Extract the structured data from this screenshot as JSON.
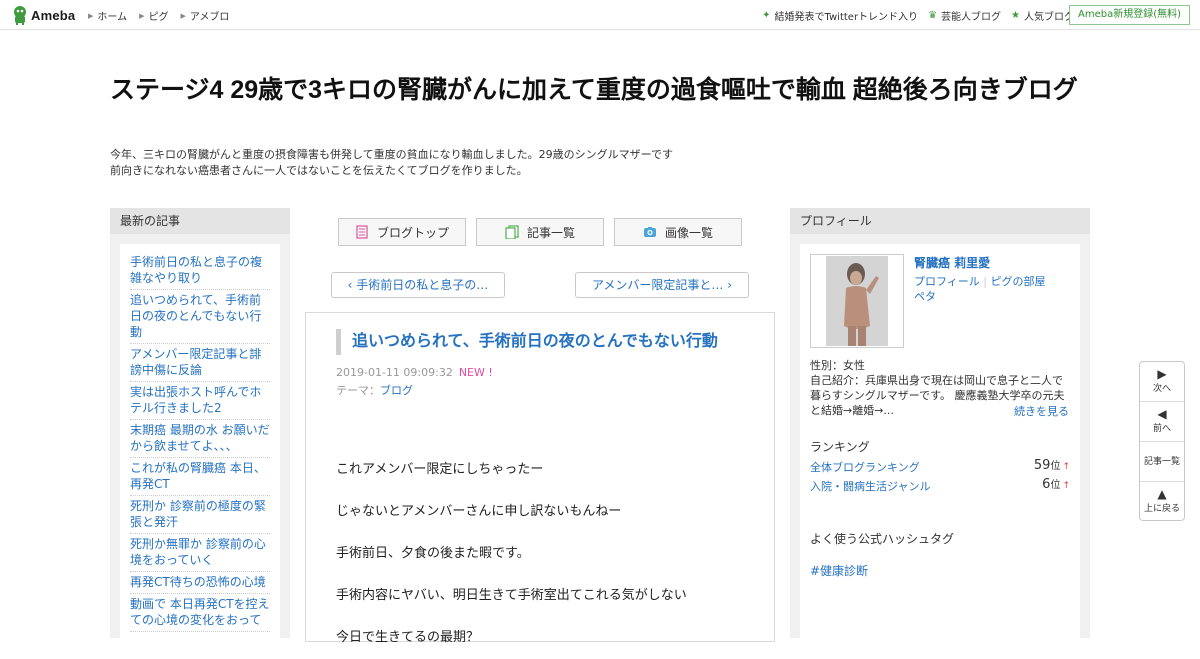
{
  "topbar": {
    "logo": "Ameba",
    "nav": [
      "ホーム",
      "ピグ",
      "アメブロ"
    ],
    "right_links": [
      {
        "icon": "sparkle-icon",
        "label": "結婚発表でTwitterトレンド入り"
      },
      {
        "icon": "crown-icon",
        "label": "芸能人ブログ"
      },
      {
        "icon": "star-icon",
        "label": "人気ブログ"
      }
    ],
    "register": "Ameba新規登録(無料)"
  },
  "blog": {
    "title": "ステージ4 29歳で3キロの腎臓がんに加えて重度の過食嘔吐で輸血 超絶後ろ向きブログ",
    "description_1": "今年、三キロの腎臓がんと重度の摂食障害も併発して重度の貧血になり輸血しました。29歳のシングルマザーです",
    "description_2": "前向きになれない癌患者さんに一人ではないことを伝えたくてブログを作りました。"
  },
  "sidebar": {
    "heading": "最新の記事",
    "items": [
      "手術前日の私と息子の複雑なやり取り",
      "追いつめられて、手術前日の夜のとんでもない行動",
      "アメンバー限定記事と誹謗中傷に反論",
      "実は出張ホスト呼んでホテル行きました2",
      "末期癌 最期の水 お願いだから飲ませてよ、、、",
      "これが私の腎臓癌 本日、再発CT",
      "死刑か 診察前の極度の緊張と発汗",
      "死刑か無罪か 診察前の心境をおっていく",
      "再発CT待ちの恐怖の心境",
      "動画で 本日再発CTを控えての心境の変化をおって"
    ]
  },
  "toolbar": {
    "blog_top": "ブログトップ",
    "entry_list": "記事一覧",
    "image_list": "画像一覧"
  },
  "pager": {
    "prev": "手術前日の私と息子の…",
    "next": "アメンバー限定記事と…"
  },
  "article": {
    "title": "追いつめられて、手術前日の夜のとんでもない行動",
    "date": "2019-01-11 09:09:32",
    "new_badge": "NEW !",
    "theme_label": "テーマ：",
    "theme": "ブログ",
    "body": [
      "これアメンバー限定にしちゃったー",
      "じゃないとアメンバーさんに申し訳ないもんねー",
      "手術前日、夕食の後また暇です。",
      "手術内容にヤバい、明日生きて手術室出てこれる気がしない",
      "今日で生きてるの最期？"
    ]
  },
  "profile": {
    "heading": "プロフィール",
    "name": "腎臓癌 莉里愛",
    "link_profile": "プロフィール",
    "link_room": "ピグの部屋",
    "link_peta": "ペタ",
    "gender": "性別：女性",
    "intro": "自己紹介：兵庫県出身で現在は岡山で息子と二人で暮らすシングルマザーです。 慶應義塾大学卒の元夫と結婚→離婚→...",
    "more": "続きを見る",
    "ranking_heading": "ランキング",
    "rankings": [
      {
        "label": "全体ブログランキング",
        "value": "59",
        "unit": "位",
        "arrow": "↑"
      },
      {
        "label": "入院・闘病生活ジャンル",
        "value": "6",
        "unit": "位",
        "arrow": "↑"
      }
    ],
    "hashtag_heading": "よく使う公式ハッシュタグ",
    "hashtag": "#健康診断"
  },
  "floatnav": {
    "next": "次へ",
    "prev": "前へ",
    "list": "記事一覧",
    "top": "上に戻る"
  }
}
